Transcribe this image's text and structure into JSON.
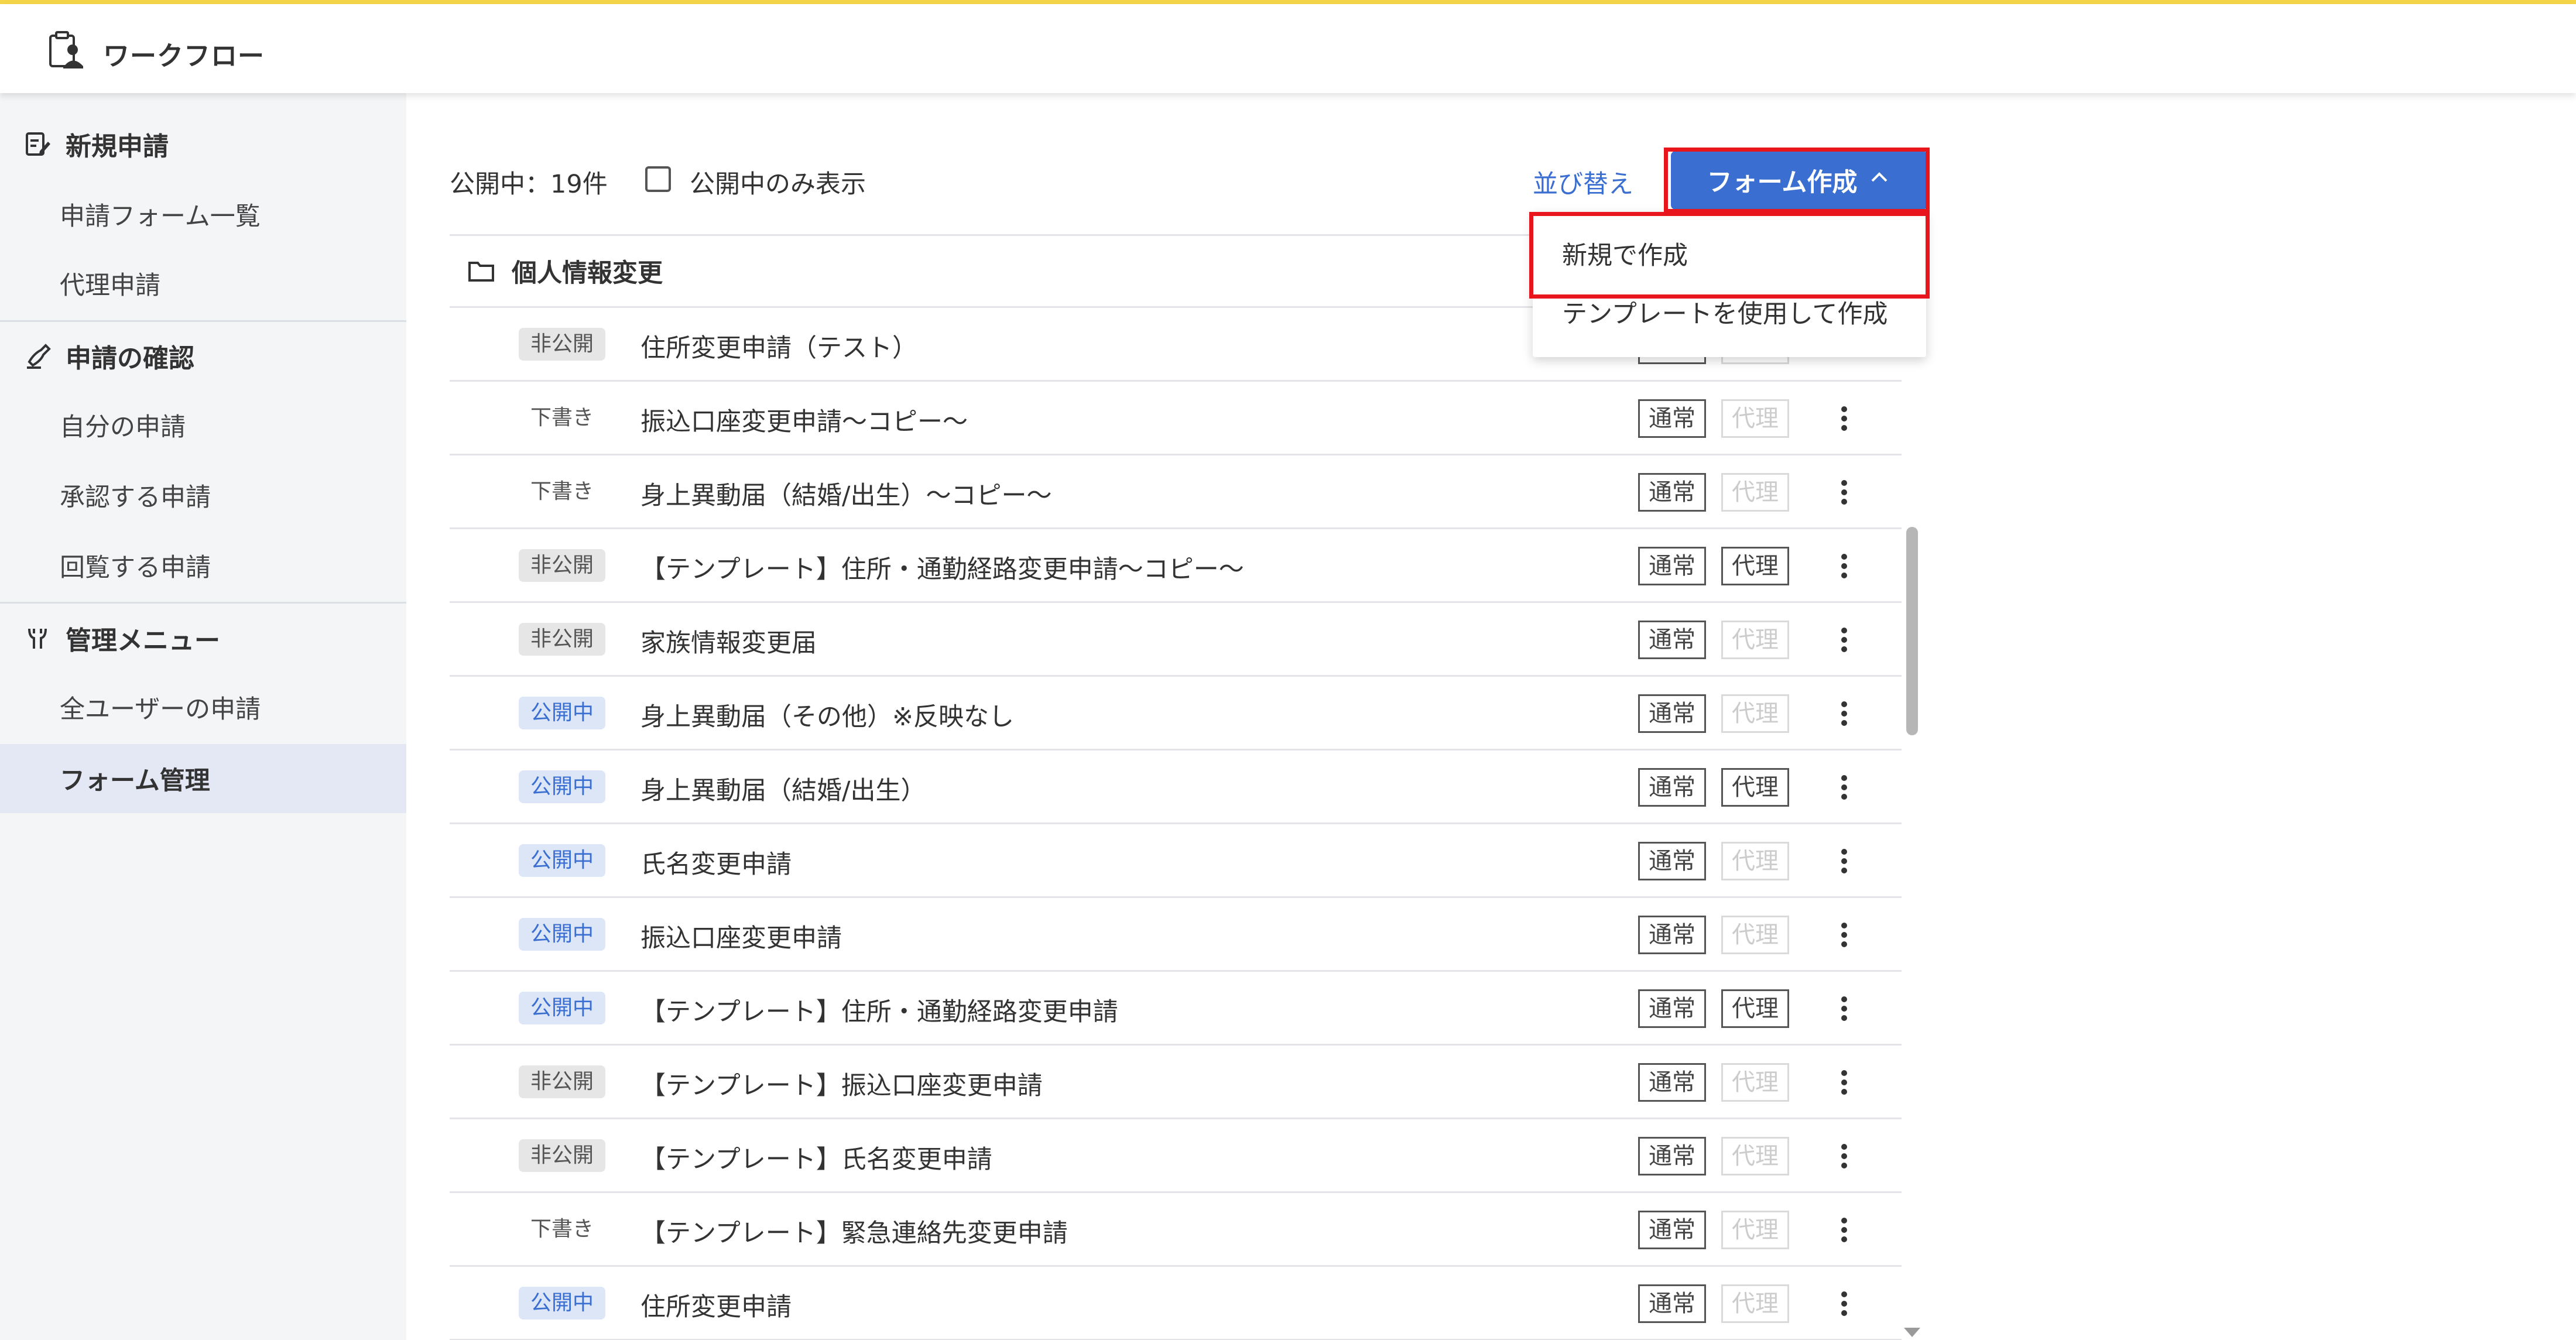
{
  "header": {
    "app_title": "ワークフロー",
    "logo_icon": "workflow-logo-icon"
  },
  "sidebar": {
    "sections": [
      {
        "label": "新規申請",
        "icon": "edit-form-icon",
        "items": [
          {
            "label": "申請フォーム一覧"
          },
          {
            "label": "代理申請"
          }
        ]
      },
      {
        "label": "申請の確認",
        "icon": "hand-stamp-icon",
        "items": [
          {
            "label": "自分の申請"
          },
          {
            "label": "承認する申請"
          },
          {
            "label": "回覧する申請"
          }
        ]
      },
      {
        "label": "管理メニュー",
        "icon": "tools-icon",
        "items": [
          {
            "label": "全ユーザーの申請"
          },
          {
            "label": "フォーム管理",
            "active": true
          }
        ]
      }
    ]
  },
  "toolbar": {
    "public_count": "公開中：19件",
    "public_only_label": "公開中のみ表示",
    "public_only_checked": false,
    "sort_label": "並び替え",
    "create_label": "フォーム作成"
  },
  "dropdown": {
    "items": [
      {
        "label": "新規で作成"
      },
      {
        "label": "テンプレートを使用して作成"
      }
    ]
  },
  "folder": {
    "name": "個人情報変更",
    "icon": "folder-icon"
  },
  "tags": {
    "normal": "通常",
    "proxy": "代理"
  },
  "rows": [
    {
      "status": "非公開",
      "status_type": "private",
      "title": "住所変更申請（テスト）",
      "normal_enabled": true,
      "proxy_enabled": false
    },
    {
      "status": "下書き",
      "status_type": "draft",
      "title": "振込口座変更申請〜コピー〜",
      "normal_enabled": true,
      "proxy_enabled": false
    },
    {
      "status": "下書き",
      "status_type": "draft",
      "title": "身上異動届（結婚/出生）〜コピー〜",
      "normal_enabled": true,
      "proxy_enabled": false
    },
    {
      "status": "非公開",
      "status_type": "private",
      "title": "【テンプレート】住所・通勤経路変更申請〜コピー〜",
      "normal_enabled": true,
      "proxy_enabled": true
    },
    {
      "status": "非公開",
      "status_type": "private",
      "title": "家族情報変更届",
      "normal_enabled": true,
      "proxy_enabled": false
    },
    {
      "status": "公開中",
      "status_type": "public",
      "title": "身上異動届（その他）※反映なし",
      "normal_enabled": true,
      "proxy_enabled": false
    },
    {
      "status": "公開中",
      "status_type": "public",
      "title": "身上異動届（結婚/出生）",
      "normal_enabled": true,
      "proxy_enabled": true
    },
    {
      "status": "公開中",
      "status_type": "public",
      "title": "氏名変更申請",
      "normal_enabled": true,
      "proxy_enabled": false
    },
    {
      "status": "公開中",
      "status_type": "public",
      "title": "振込口座変更申請",
      "normal_enabled": true,
      "proxy_enabled": false
    },
    {
      "status": "公開中",
      "status_type": "public",
      "title": "【テンプレート】住所・通勤経路変更申請",
      "normal_enabled": true,
      "proxy_enabled": true
    },
    {
      "status": "非公開",
      "status_type": "private",
      "title": "【テンプレート】振込口座変更申請",
      "normal_enabled": true,
      "proxy_enabled": false
    },
    {
      "status": "非公開",
      "status_type": "private",
      "title": "【テンプレート】氏名変更申請",
      "normal_enabled": true,
      "proxy_enabled": false
    },
    {
      "status": "下書き",
      "status_type": "draft",
      "title": "【テンプレート】緊急連絡先変更申請",
      "normal_enabled": true,
      "proxy_enabled": false
    },
    {
      "status": "公開中",
      "status_type": "public",
      "title": "住所変更申請",
      "normal_enabled": true,
      "proxy_enabled": false
    }
  ],
  "colors": {
    "accent": "#3a6fd1",
    "highlight": "#e8161c",
    "top_line": "#f4d449",
    "active_bg": "#e3e8f4"
  }
}
